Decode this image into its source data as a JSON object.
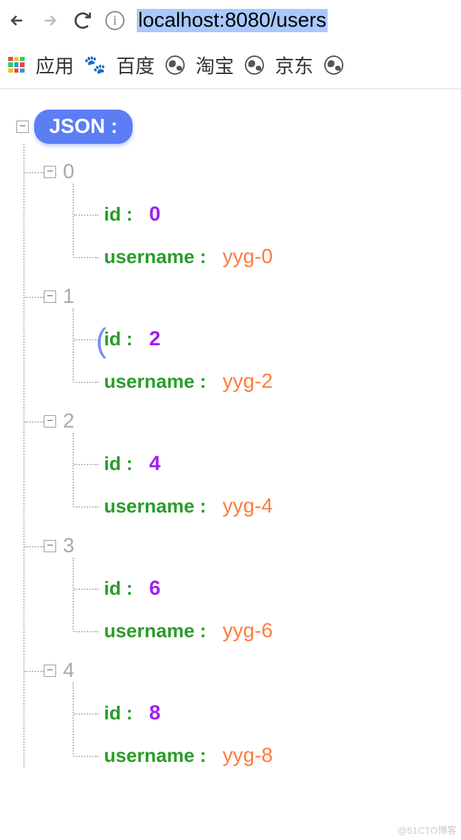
{
  "url": "localhost:8080/users",
  "bookmarks_bar": {
    "apps": "应用",
    "baidu": "百度",
    "taobao": "淘宝",
    "jd": "京东"
  },
  "json_label": "JSON :",
  "key_id": "id :",
  "key_username": "username :",
  "items": [
    {
      "index": "0",
      "id": "0",
      "username": "yyg-0"
    },
    {
      "index": "1",
      "id": "2",
      "username": "yyg-2"
    },
    {
      "index": "2",
      "id": "4",
      "username": "yyg-4"
    },
    {
      "index": "3",
      "id": "6",
      "username": "yyg-6"
    },
    {
      "index": "4",
      "id": "8",
      "username": "yyg-8"
    }
  ],
  "watermark": "@51CTO博客"
}
